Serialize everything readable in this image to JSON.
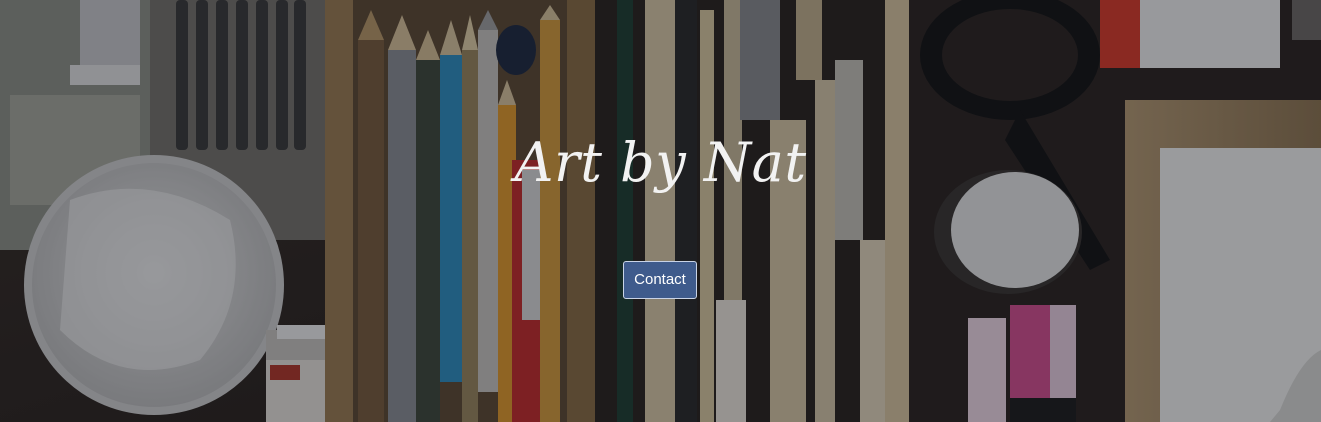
{
  "hero": {
    "title": "Art by Nat",
    "contact_label": "Contact",
    "background_image": "art-supplies-flatlay"
  },
  "colors": {
    "button_bg": "#3f5b8c",
    "button_border": "#c9d3e6",
    "title_text": "#f2f2f2",
    "overlay": "rgba(10,12,20,0.38)"
  }
}
